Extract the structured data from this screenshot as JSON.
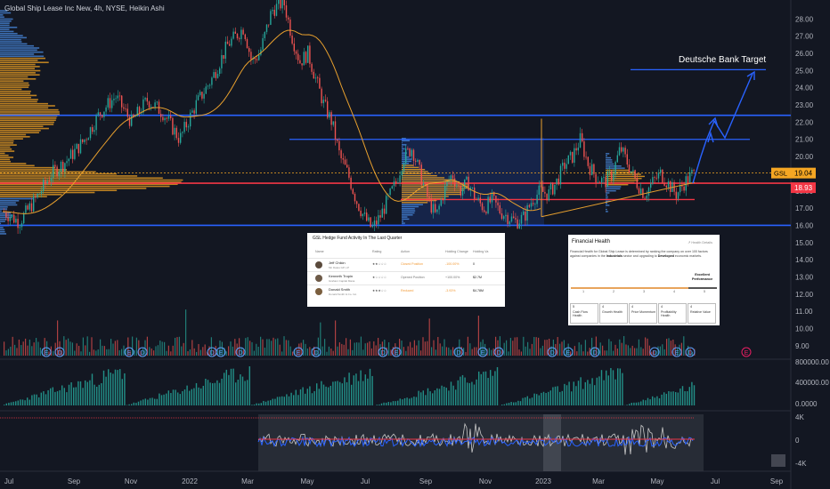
{
  "chart_data": {
    "type": "candlestick",
    "title": "Global Ship Lease Inc New, 4h, NYSE, Heikin Ashi",
    "annotation": "Deutsche Bank  Target",
    "x_labels": [
      "Jul",
      "Sep",
      "Nov",
      "2022",
      "Mar",
      "May",
      "Jul",
      "Sep",
      "Nov",
      "2023",
      "Mar",
      "May",
      "Jul",
      "Sep"
    ],
    "price_axis": {
      "ylim": [
        8.0,
        29.0
      ],
      "ticks": [
        "28.00",
        "27.00",
        "26.00",
        "25.00",
        "24.00",
        "23.00",
        "22.00",
        "21.00",
        "20.00",
        "19.00",
        "18.00",
        "17.00",
        "16.00",
        "15.00",
        "14.00",
        "13.00",
        "12.00",
        "11.00",
        "10.00",
        "9.00"
      ],
      "last_price_label": "19.04",
      "ticker_label": "GSL",
      "second_price_label": "18.93"
    },
    "volume_axis": {
      "ticks": [
        "800000.00",
        "400000.00",
        "0.0000"
      ]
    },
    "oscillator_axis": {
      "ticks": [
        "4K",
        "0",
        "-4K"
      ]
    },
    "horizontal_lines": [
      {
        "color": "#2962ff",
        "value": 22.4
      },
      {
        "color": "#2962ff",
        "value": 21.0
      },
      {
        "color": "#2962ff",
        "value": 16.0
      },
      {
        "color": "#2962ff",
        "value": 25.05
      },
      {
        "color": "#f23645",
        "value": 18.45
      },
      {
        "color": "#f23645",
        "value": 17.5
      }
    ],
    "price_path": [
      [
        0,
        16.8
      ],
      [
        0.02,
        16.2
      ],
      [
        0.04,
        17.5
      ],
      [
        0.06,
        19.0
      ],
      [
        0.08,
        19.8
      ],
      [
        0.1,
        20.9
      ],
      [
        0.12,
        22.5
      ],
      [
        0.14,
        23.5
      ],
      [
        0.16,
        22.0
      ],
      [
        0.18,
        23.3
      ],
      [
        0.2,
        22.5
      ],
      [
        0.22,
        21.0
      ],
      [
        0.24,
        23.0
      ],
      [
        0.26,
        24.5
      ],
      [
        0.28,
        26.5
      ],
      [
        0.3,
        27.5
      ],
      [
        0.31,
        25.5
      ],
      [
        0.32,
        26.0
      ],
      [
        0.335,
        28.5
      ],
      [
        0.35,
        29.0
      ],
      [
        0.36,
        27.0
      ],
      [
        0.37,
        25.5
      ],
      [
        0.38,
        26.0
      ],
      [
        0.39,
        24.5
      ],
      [
        0.4,
        23.0
      ],
      [
        0.41,
        22.0
      ],
      [
        0.42,
        20.0
      ],
      [
        0.43,
        19.0
      ],
      [
        0.44,
        17.5
      ],
      [
        0.45,
        16.5
      ],
      [
        0.46,
        15.8
      ],
      [
        0.47,
        16.5
      ],
      [
        0.48,
        17.5
      ],
      [
        0.49,
        18.5
      ],
      [
        0.5,
        20.0
      ],
      [
        0.51,
        20.5
      ],
      [
        0.52,
        19.0
      ],
      [
        0.53,
        17.5
      ],
      [
        0.54,
        16.5
      ],
      [
        0.55,
        18.0
      ],
      [
        0.56,
        19.0
      ],
      [
        0.57,
        18.0
      ],
      [
        0.58,
        18.5
      ],
      [
        0.59,
        17.5
      ],
      [
        0.6,
        17.0
      ],
      [
        0.61,
        17.5
      ],
      [
        0.62,
        16.8
      ],
      [
        0.63,
        16.5
      ],
      [
        0.64,
        16.2
      ],
      [
        0.65,
        16.5
      ],
      [
        0.66,
        17.5
      ],
      [
        0.67,
        18.0
      ],
      [
        0.68,
        17.8
      ],
      [
        0.69,
        18.5
      ],
      [
        0.7,
        19.5
      ],
      [
        0.71,
        20.0
      ],
      [
        0.72,
        21.0
      ],
      [
        0.73,
        19.5
      ],
      [
        0.74,
        18.8
      ],
      [
        0.75,
        18.5
      ],
      [
        0.76,
        19.0
      ],
      [
        0.77,
        20.5
      ],
      [
        0.78,
        19.5
      ],
      [
        0.79,
        18.5
      ],
      [
        0.8,
        17.8
      ],
      [
        0.81,
        18.5
      ],
      [
        0.82,
        19.0
      ],
      [
        0.83,
        18.4
      ],
      [
        0.84,
        17.8
      ],
      [
        0.85,
        18.5
      ],
      [
        0.86,
        19.0
      ]
    ],
    "histogram": "green bars rising on each cycle",
    "oscillator": "multicolor line around zero"
  },
  "hedge_card": {
    "title": "GSL Hedge Fund Activity In The Last Quarter",
    "headers": [
      "Name",
      "Rating",
      "Action",
      "Holding Change",
      "Holding Va"
    ],
    "rows": [
      {
        "name": "Jeff Chikin",
        "fund": "Mn Dates GP, LP",
        "rating": "★★☆☆☆",
        "action": "Closed Position",
        "change": "-100.00%",
        "value": "0",
        "action_color": "#f29b38",
        "change_color": "#f29b38"
      },
      {
        "name": "Kenneth Tropin",
        "fund": "Graham Capital Mana",
        "rating": "★☆☆☆☆",
        "action": "Opened Position",
        "change": "+100.00%",
        "value": "$2.7M",
        "action_color": "#777777",
        "change_color": "#777777"
      },
      {
        "name": "Donald Smith",
        "fund": "Donald Smith & Co. Inc.",
        "rating": "★★★☆☆",
        "action": "Reduced",
        "change": "-3.93%",
        "value": "$4.78M",
        "action_color": "#f29b38",
        "change_color": "#f29b38"
      }
    ]
  },
  "health_card": {
    "title": "Financial Health",
    "link": "Health Details",
    "desc_a": "Financial Health for Global Ship Lease is determined by ranking the company on over 100 factors against companies in the ",
    "desc_b": "Industrials",
    "desc_c": " sector and upgrading to ",
    "desc_d": "Developed",
    "desc_e": " economic markets.",
    "perf_1": "Excellent",
    "perf_2": "Performance",
    "scale": [
      "1",
      "2",
      "3",
      "4",
      "5"
    ],
    "boxes": [
      {
        "n": "5",
        "l": "Cash Flow Health"
      },
      {
        "n": "4",
        "l": "Growth Health"
      },
      {
        "n": "4",
        "l": "Price Momentum"
      },
      {
        "n": "4",
        "l": "Profitability Health"
      },
      {
        "n": "4",
        "l": "Relative Value"
      }
    ]
  },
  "colors": {
    "bg": "#131722",
    "up": "#26a69a",
    "down": "#ef5350",
    "blue": "#2962ff",
    "red": "#f23645",
    "orange": "#f5a623",
    "vp": "#4b8ee6"
  }
}
